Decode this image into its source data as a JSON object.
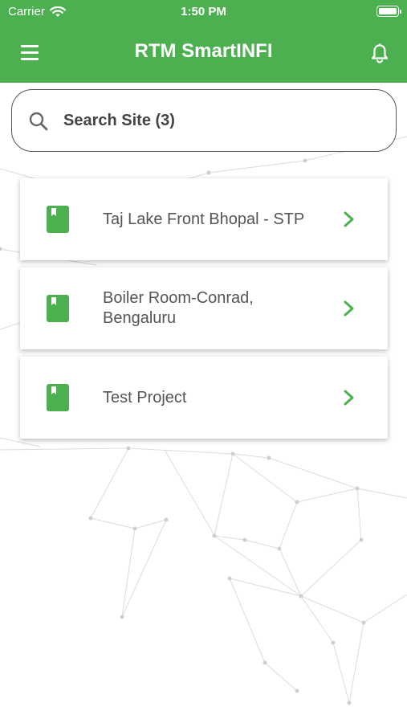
{
  "status_bar": {
    "carrier": "Carrier",
    "time": "1:50 PM"
  },
  "header": {
    "title": "RTM SmartINFI",
    "menu_icon": "hamburger-menu-icon",
    "bell_icon": "notification-bell-icon"
  },
  "search": {
    "placeholder": "Search Site (3)",
    "value": ""
  },
  "sites": [
    {
      "name": "Taj Lake Front Bhopal - STP"
    },
    {
      "name": "Boiler Room-Conrad, Bengaluru"
    },
    {
      "name": "Test Project"
    }
  ],
  "colors": {
    "primary": "#4caf50",
    "text": "#555555"
  }
}
